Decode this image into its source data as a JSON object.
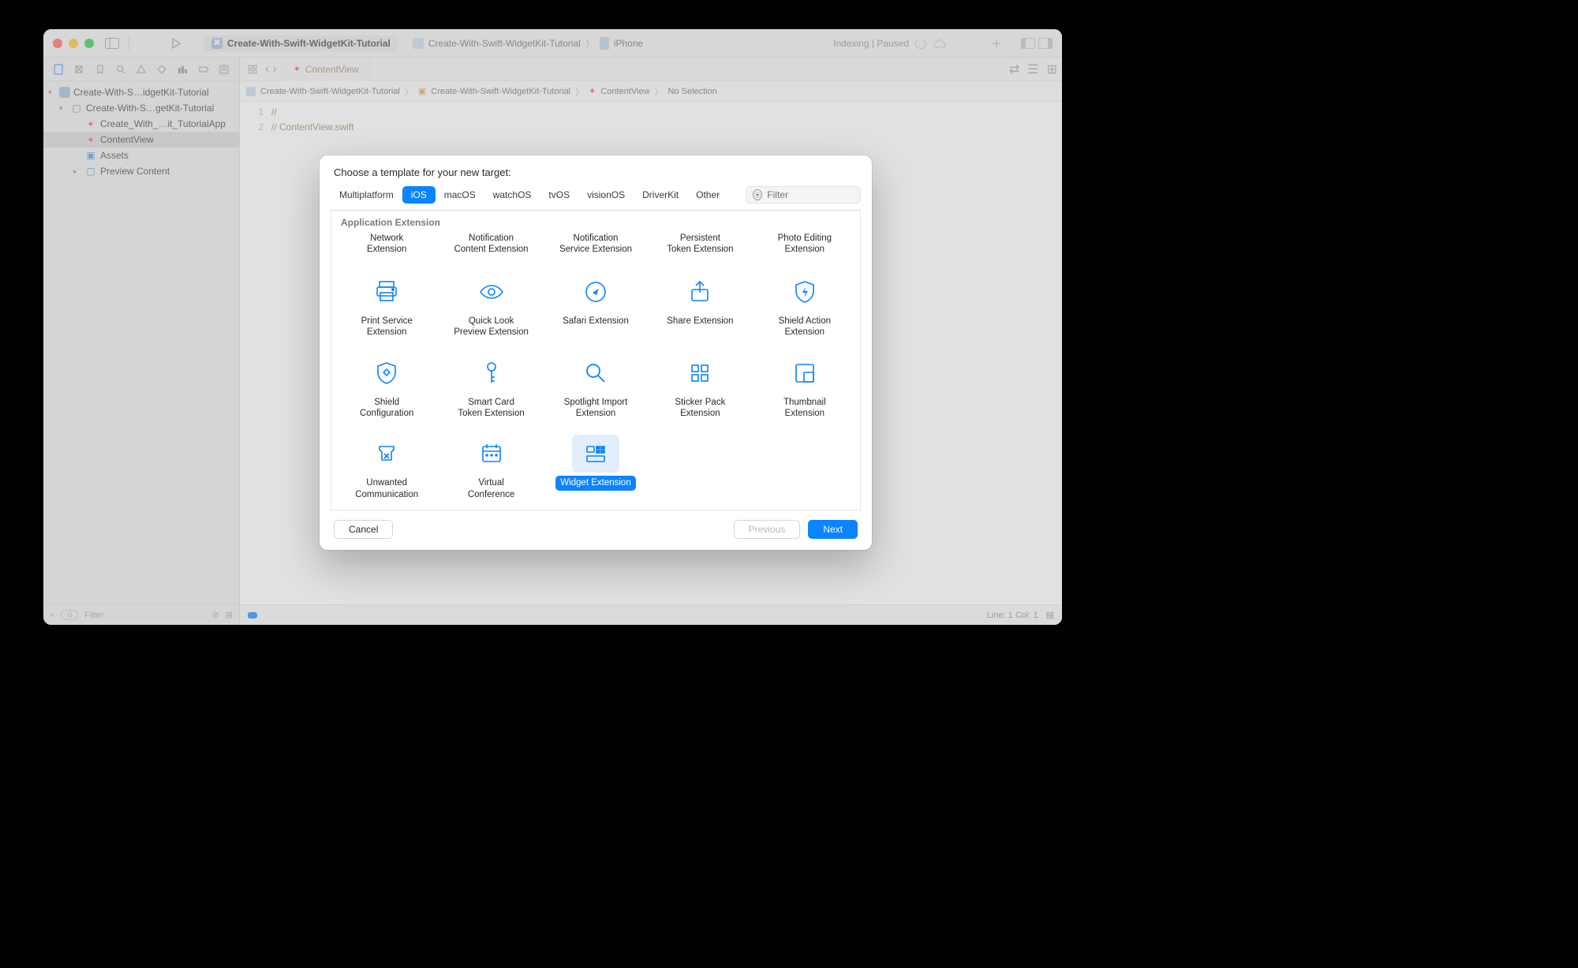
{
  "window": {
    "scheme_title": "Create-With-Swift-WidgetKit-Tutorial",
    "breadcrumb_project": "Create-With-Swift-WidgetKit-Tutorial",
    "breadcrumb_device": "iPhone",
    "status": "Indexing | Paused"
  },
  "navigator": {
    "project": "Create-With-S…idgetKit-Tutorial",
    "folder": "Create-With-S…getKit-Tutorial",
    "files": [
      "Create_With_…it_TutorialApp",
      "ContentView",
      "Assets",
      "Preview Content"
    ],
    "filter_placeholder": "Filter"
  },
  "tab": {
    "name": "ContentView"
  },
  "jumpbar": {
    "a": "Create-With-Swift-WidgetKit-Tutorial",
    "b": "Create-With-Swift-WidgetKit-Tutorial",
    "c": "ContentView",
    "d": "No Selection"
  },
  "code": {
    "l1": "//",
    "l2": "//  ContentView.swift"
  },
  "footer": {
    "pos": "Line: 1  Col: 1"
  },
  "sheet": {
    "title": "Choose a template for your new target:",
    "platforms": [
      "Multiplatform",
      "iOS",
      "macOS",
      "watchOS",
      "tvOS",
      "visionOS",
      "DriverKit",
      "Other"
    ],
    "selected_platform": "iOS",
    "filter_placeholder": "Filter",
    "section": "Application Extension",
    "templates_row0": [
      "Network\nExtension",
      "Notification\nContent Extension",
      "Notification\nService Extension",
      "Persistent\nToken Extension",
      "Photo Editing\nExtension"
    ],
    "templates_row1": [
      "Print Service\nExtension",
      "Quick Look\nPreview Extension",
      "Safari Extension",
      "Share Extension",
      "Shield Action\nExtension"
    ],
    "templates_row2": [
      "Shield\nConfiguration",
      "Smart Card\nToken Extension",
      "Spotlight Import\nExtension",
      "Sticker Pack\nExtension",
      "Thumbnail\nExtension"
    ],
    "templates_row3": [
      "Unwanted\nCommunication",
      "Virtual\nConference",
      "Widget Extension"
    ],
    "selected_template": "Widget Extension",
    "cancel": "Cancel",
    "previous": "Previous",
    "next": "Next"
  }
}
